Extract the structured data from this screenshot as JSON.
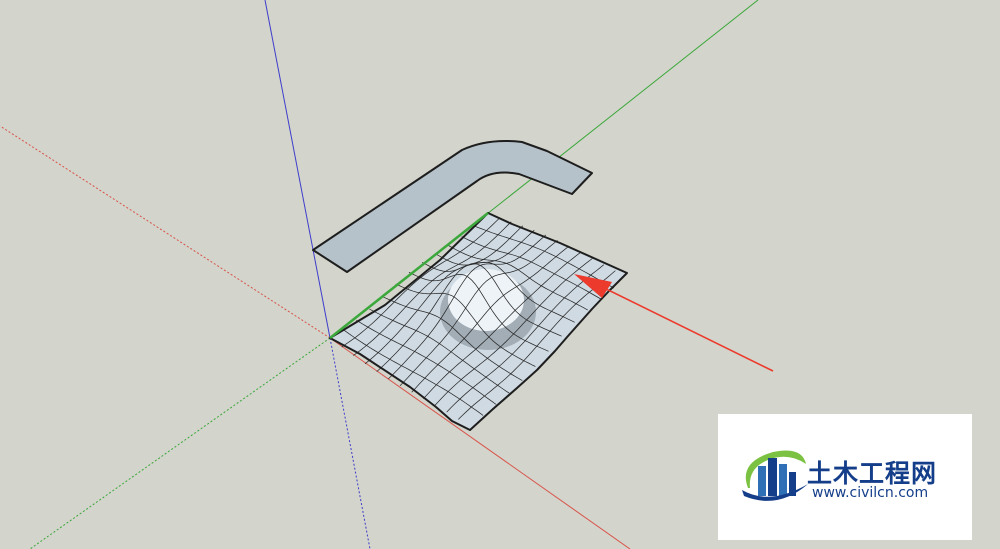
{
  "viewport": {
    "background": "#d3d4cb",
    "axis_colors": {
      "red": "#d9534a",
      "green": "#3aa83a",
      "blue": "#3d3dcc"
    }
  },
  "scene": {
    "objects": [
      {
        "name": "bent path profile",
        "fill": "#b6c2ca"
      },
      {
        "name": "terrain mesh",
        "fill": "#cfdae3"
      }
    ],
    "annotation_arrow": {
      "color": "#ec3a2c"
    }
  },
  "watermark": {
    "brand": "土木工程网",
    "url": "www.civilcn.com",
    "colors": {
      "primary": "#153e8a",
      "accent": "#7cc242"
    }
  }
}
